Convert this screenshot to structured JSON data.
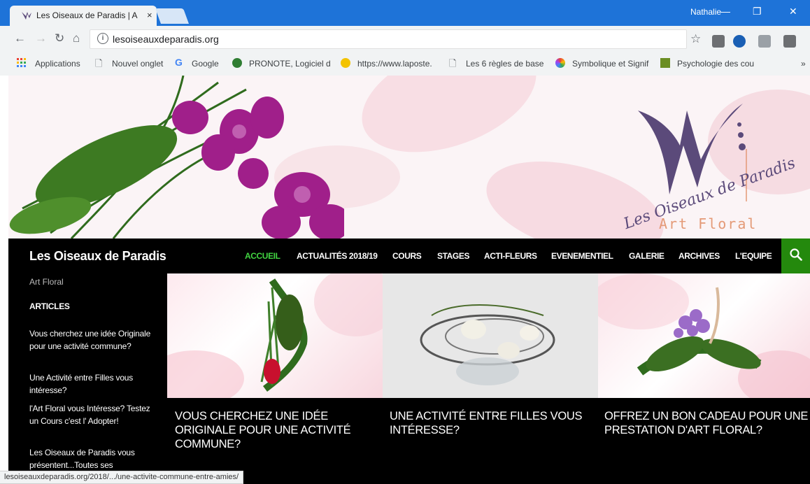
{
  "browser": {
    "tab_title": "Les Oiseaux de Paradis | A",
    "tab_close": "×",
    "user": "Nathalie",
    "url": "lesoiseauxdeparadis.org",
    "status_url": "lesoiseauxdeparadis.org/2018/.../une-activite-commune-entre-amies/",
    "bookmarks": [
      {
        "label": "Applications"
      },
      {
        "label": "Nouvel onglet"
      },
      {
        "label": "Google"
      },
      {
        "label": "PRONOTE, Logiciel d"
      },
      {
        "label": "https://www.laposte."
      },
      {
        "label": "Les 6 règles de base"
      },
      {
        "label": "Symbolique et Signif"
      },
      {
        "label": "Psychologie des cou"
      }
    ],
    "bookmarks_more": "»"
  },
  "site": {
    "title": "Les Oiseaux de Paradis",
    "tagline": "Art Floral",
    "logo_script": "Les Oiseaux de Paradis",
    "logo_sub": "Art Floral",
    "menu": [
      "ACCUEIL",
      "ACTUALITÉS 2018/19",
      "COURS",
      "STAGES",
      "ACTI-FLEURS",
      "EVENEMENTIEL",
      "GALERIE",
      "ARCHIVES",
      "L'EQUIPE"
    ],
    "sidebar": {
      "heading": "ARTICLES",
      "links": [
        "Vous cherchez une idée Originale pour une activité commune?",
        "Une Activité entre Filles vous intéresse?",
        "l'Art Floral vous Intéresse? Testez un Cours c'est l' Adopter!",
        "Les Oiseaux de Paradis vous présentent...Toutes ses"
      ]
    },
    "featured": [
      {
        "title": "VOUS CHERCHEZ UNE IDÉE ORIGINALE POUR UNE ACTIVITÉ COMMUNE?"
      },
      {
        "title": "UNE ACTIVITÉ ENTRE FILLES VOUS INTÉRESSE?"
      },
      {
        "title": "OFFREZ UN BON CADEAU POUR UNE PRESTATION D'ART FLORAL?"
      }
    ]
  },
  "colors": {
    "accent_green": "#24890d",
    "active_menu": "#41d441",
    "chrome_blue": "#1e73d8"
  }
}
